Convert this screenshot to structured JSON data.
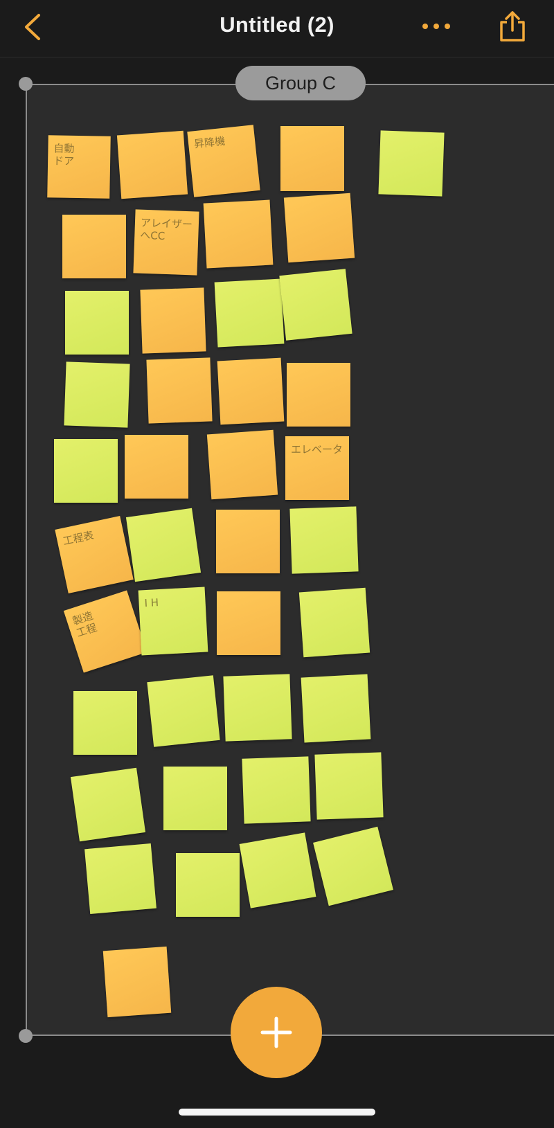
{
  "nav": {
    "title": "Untitled (2)",
    "back_icon": "chevron-left-icon",
    "more_icon": "more-dots-icon",
    "share_icon": "share-icon",
    "accent_color": "#f2a93b"
  },
  "group": {
    "label": "Group C"
  },
  "notes": [
    {
      "color": "orange",
      "text": "自動\nドア"
    },
    {
      "color": "orange",
      "text": ""
    },
    {
      "color": "orange",
      "text": "昇降機"
    },
    {
      "color": "orange",
      "text": ""
    },
    {
      "color": "green",
      "text": ""
    },
    {
      "color": "orange",
      "text": ""
    },
    {
      "color": "orange",
      "text": "アレイザー\nへCC"
    },
    {
      "color": "orange",
      "text": ""
    },
    {
      "color": "orange",
      "text": ""
    },
    {
      "color": "green",
      "text": ""
    },
    {
      "color": "orange",
      "text": ""
    },
    {
      "color": "green",
      "text": ""
    },
    {
      "color": "green",
      "text": ""
    },
    {
      "color": "green",
      "text": ""
    },
    {
      "color": "orange",
      "text": ""
    },
    {
      "color": "orange",
      "text": ""
    },
    {
      "color": "orange",
      "text": ""
    },
    {
      "color": "green",
      "text": ""
    },
    {
      "color": "orange",
      "text": ""
    },
    {
      "color": "orange",
      "text": ""
    },
    {
      "color": "orange",
      "text": "エレベータ"
    },
    {
      "color": "orange",
      "text": "工程表"
    },
    {
      "color": "green",
      "text": ""
    },
    {
      "color": "orange",
      "text": ""
    },
    {
      "color": "green",
      "text": ""
    },
    {
      "color": "orange",
      "text": "製造\n工程"
    },
    {
      "color": "green",
      "text": "I H"
    },
    {
      "color": "orange",
      "text": ""
    },
    {
      "color": "green",
      "text": ""
    },
    {
      "color": "green",
      "text": ""
    },
    {
      "color": "green",
      "text": ""
    },
    {
      "color": "green",
      "text": ""
    },
    {
      "color": "green",
      "text": ""
    },
    {
      "color": "green",
      "text": ""
    },
    {
      "color": "green",
      "text": ""
    },
    {
      "color": "green",
      "text": ""
    },
    {
      "color": "green",
      "text": ""
    },
    {
      "color": "green",
      "text": ""
    },
    {
      "color": "green",
      "text": ""
    },
    {
      "color": "green",
      "text": ""
    },
    {
      "color": "green",
      "text": ""
    },
    {
      "color": "orange",
      "text": ""
    }
  ],
  "fab": {
    "icon": "plus-icon",
    "color": "#f2a93b"
  }
}
